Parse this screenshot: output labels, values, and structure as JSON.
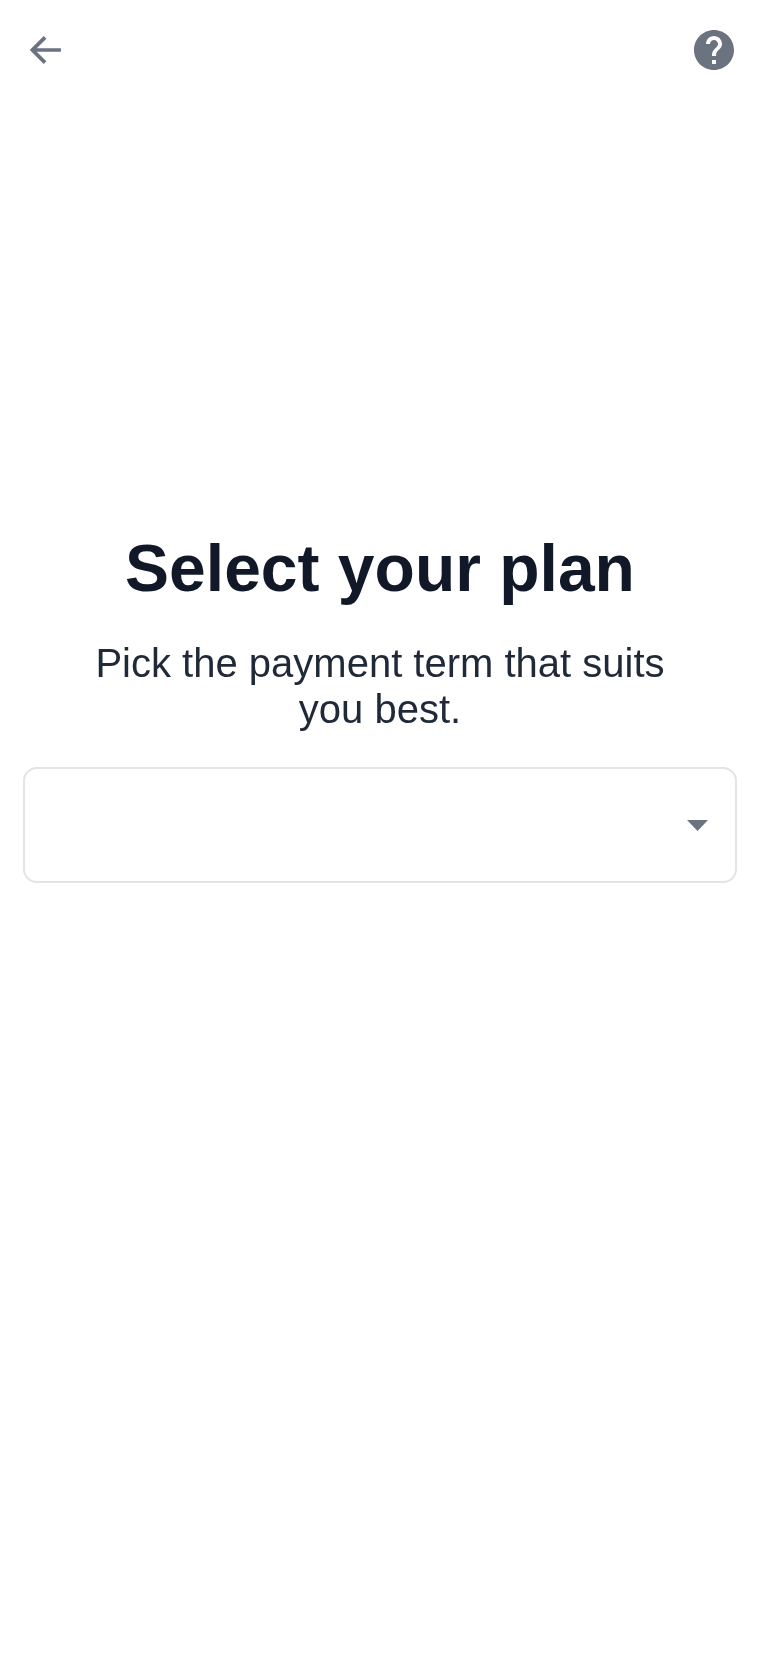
{
  "title": "Select your plan",
  "subtitle": "Pick the payment term that suits you best.",
  "plan_select": {
    "expanded": false
  }
}
